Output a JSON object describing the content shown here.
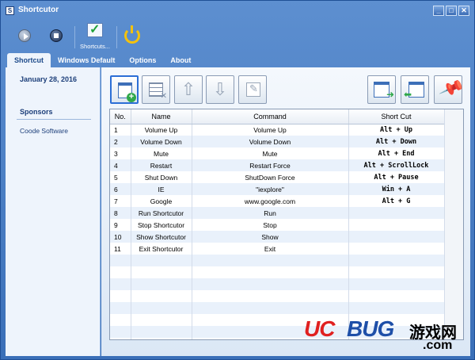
{
  "window": {
    "title": "Shortcutor",
    "app_icon": "S",
    "minimize": "_",
    "maximize": "□",
    "close": "✕"
  },
  "toolbar": {
    "shortcuts_label": "Shortcuts..."
  },
  "tabs": [
    {
      "label": "Shortcut",
      "active": true
    },
    {
      "label": "Windows Default",
      "active": false
    },
    {
      "label": "Options",
      "active": false
    },
    {
      "label": "About",
      "active": false
    }
  ],
  "sidebar": {
    "date": "January 28, 2016",
    "sponsors_title": "Sponsors",
    "sponsor_link": "Coode Software"
  },
  "action_icons": [
    "add-shortcut-icon",
    "delete-shortcut-icon",
    "move-up-icon",
    "move-down-icon",
    "edit-shortcut-icon",
    "import-icon",
    "export-icon",
    "pin-icon"
  ],
  "table": {
    "headers": [
      "No.",
      "Name",
      "Command",
      "Short Cut"
    ],
    "rows": [
      [
        "1",
        "Volume Up",
        "Volume Up",
        "Alt + Up"
      ],
      [
        "2",
        "Volume Down",
        "Volume Down",
        "Alt + Down"
      ],
      [
        "3",
        "Mute",
        "Mute",
        "Alt + End"
      ],
      [
        "4",
        "Restart",
        "Restart Force",
        "Alt + ScrollLock"
      ],
      [
        "5",
        "Shut Down",
        "ShutDown Force",
        "Alt + Pause"
      ],
      [
        "6",
        "IE",
        "\"iexplore\"",
        "Win + A"
      ],
      [
        "7",
        "Google",
        "www.google.com",
        "Alt + G"
      ],
      [
        "8",
        "Run Shortcutor",
        "Run",
        ""
      ],
      [
        "9",
        "Stop Shortcutor",
        "Stop",
        ""
      ],
      [
        "10",
        "Show Shortcutor",
        "Show",
        ""
      ],
      [
        "11",
        "Exit Shortcutor",
        "Exit",
        ""
      ],
      [
        "",
        "",
        "",
        ""
      ],
      [
        "",
        "",
        "",
        ""
      ],
      [
        "",
        "",
        "",
        ""
      ],
      [
        "",
        "",
        "",
        ""
      ],
      [
        "",
        "",
        "",
        ""
      ],
      [
        "",
        "",
        "",
        ""
      ],
      [
        "",
        "",
        "",
        ""
      ],
      [
        "",
        "",
        "",
        ""
      ]
    ]
  },
  "watermark": {
    "uc": "UC",
    "bug": "BUG",
    "cn": "游戏网",
    "com": ".com"
  },
  "colors": {
    "titlebar": "#3a6fb8",
    "accent": "#2c6fd6",
    "alt_row": "#e9f1fb"
  }
}
